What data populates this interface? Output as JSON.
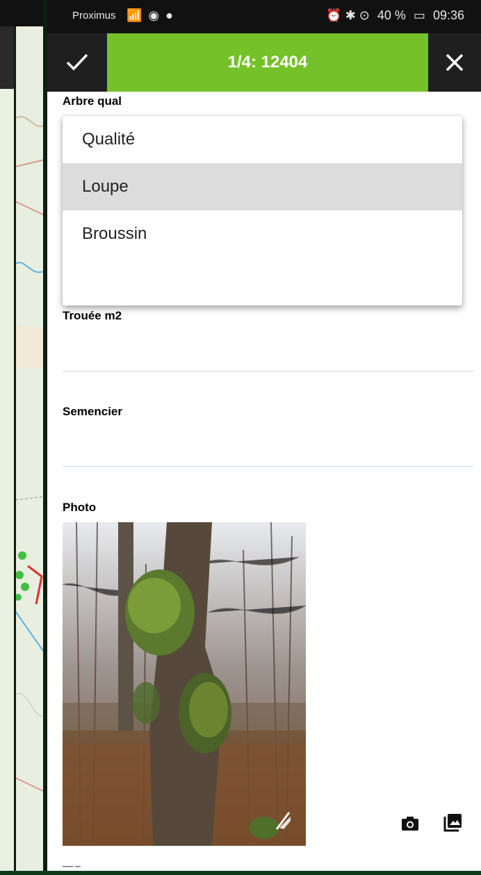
{
  "status_bar": {
    "carrier": "Proximus",
    "signal_icons": "📶 ◉ ●",
    "alarm_bt_location": "⏰ ✱ ⊙",
    "battery_percent": "40 %",
    "time": "09:36"
  },
  "header": {
    "title": "1/4: 12404",
    "accent_color": "#75c12a"
  },
  "form": {
    "arbre_qual": {
      "label": "Arbre qual",
      "options": [
        "Qualité",
        "Loupe",
        "Broussin"
      ],
      "selected": "Loupe"
    },
    "trouee": {
      "label": "Trouée m2",
      "value": ""
    },
    "semencier": {
      "label": "Semencier",
      "value": ""
    },
    "photo": {
      "label": "Photo"
    }
  }
}
